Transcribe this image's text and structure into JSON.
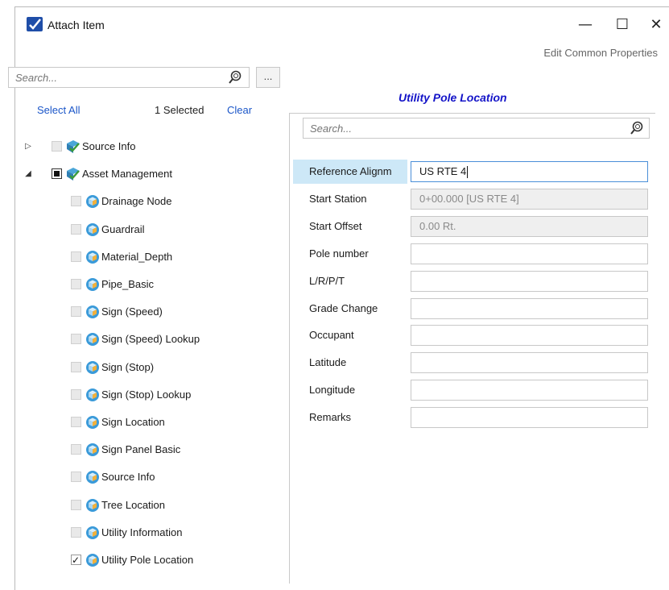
{
  "window": {
    "title": "Attach Item",
    "minimize_glyph": "—",
    "maximize_glyph": "☐",
    "close_glyph": "✕",
    "edit_common_properties": "Edit Common Properties"
  },
  "left": {
    "search_placeholder": "Search...",
    "more_button": "...",
    "select_all": "Select All",
    "selected_count": "1 Selected",
    "clear": "Clear",
    "tree": [
      {
        "label": "Source Info",
        "level": 0,
        "expander": "▷",
        "check": "unchecked",
        "icon": "category-check-icon"
      },
      {
        "label": "Asset Management",
        "level": 0,
        "expander": "◢",
        "check": "partial",
        "icon": "category-check-icon"
      },
      {
        "label": "Drainage Node",
        "level": 1,
        "check": "unchecked",
        "icon": "item-type-icon"
      },
      {
        "label": "Guardrail",
        "level": 1,
        "check": "unchecked",
        "icon": "item-type-icon"
      },
      {
        "label": "Material_Depth",
        "level": 1,
        "check": "unchecked",
        "icon": "item-type-icon"
      },
      {
        "label": "Pipe_Basic",
        "level": 1,
        "check": "unchecked",
        "icon": "item-type-icon"
      },
      {
        "label": "Sign (Speed)",
        "level": 1,
        "check": "unchecked",
        "icon": "item-type-icon"
      },
      {
        "label": "Sign (Speed) Lookup",
        "level": 1,
        "check": "unchecked",
        "icon": "item-type-icon"
      },
      {
        "label": "Sign (Stop)",
        "level": 1,
        "check": "unchecked",
        "icon": "item-type-icon"
      },
      {
        "label": "Sign (Stop) Lookup",
        "level": 1,
        "check": "unchecked",
        "icon": "item-type-icon"
      },
      {
        "label": "Sign Location",
        "level": 1,
        "check": "unchecked",
        "icon": "item-type-icon"
      },
      {
        "label": "Sign Panel Basic",
        "level": 1,
        "check": "unchecked",
        "icon": "item-type-icon"
      },
      {
        "label": "Source Info",
        "level": 1,
        "check": "unchecked",
        "icon": "item-type-icon"
      },
      {
        "label": "Tree Location",
        "level": 1,
        "check": "unchecked",
        "icon": "item-type-icon"
      },
      {
        "label": "Utility Information",
        "level": 1,
        "check": "unchecked",
        "icon": "item-type-icon"
      },
      {
        "label": "Utility Pole Location",
        "level": 1,
        "check": "checked",
        "icon": "item-type-icon"
      }
    ]
  },
  "right": {
    "title": "Utility Pole Location",
    "search_placeholder": "Search...",
    "properties": [
      {
        "label": "Reference Alignm",
        "value": "US RTE 4",
        "state": "focused"
      },
      {
        "label": "Start Station",
        "value": "0+00.000 [US RTE 4]",
        "state": "readonly"
      },
      {
        "label": "Start Offset",
        "value": "0.00 Rt.",
        "state": "readonly"
      },
      {
        "label": "Pole number",
        "value": "",
        "state": "editable"
      },
      {
        "label": "L/R/P/T",
        "value": "",
        "state": "editable"
      },
      {
        "label": "Grade Change",
        "value": "",
        "state": "editable"
      },
      {
        "label": "Occupant",
        "value": "",
        "state": "editable"
      },
      {
        "label": "Latitude",
        "value": "",
        "state": "editable"
      },
      {
        "label": "Longitude",
        "value": "",
        "state": "editable"
      },
      {
        "label": "Remarks",
        "value": "",
        "state": "editable"
      }
    ]
  },
  "colors": {
    "link": "#1b56c8",
    "title_accent": "#1414c8",
    "active_row": "#cde8f7"
  }
}
